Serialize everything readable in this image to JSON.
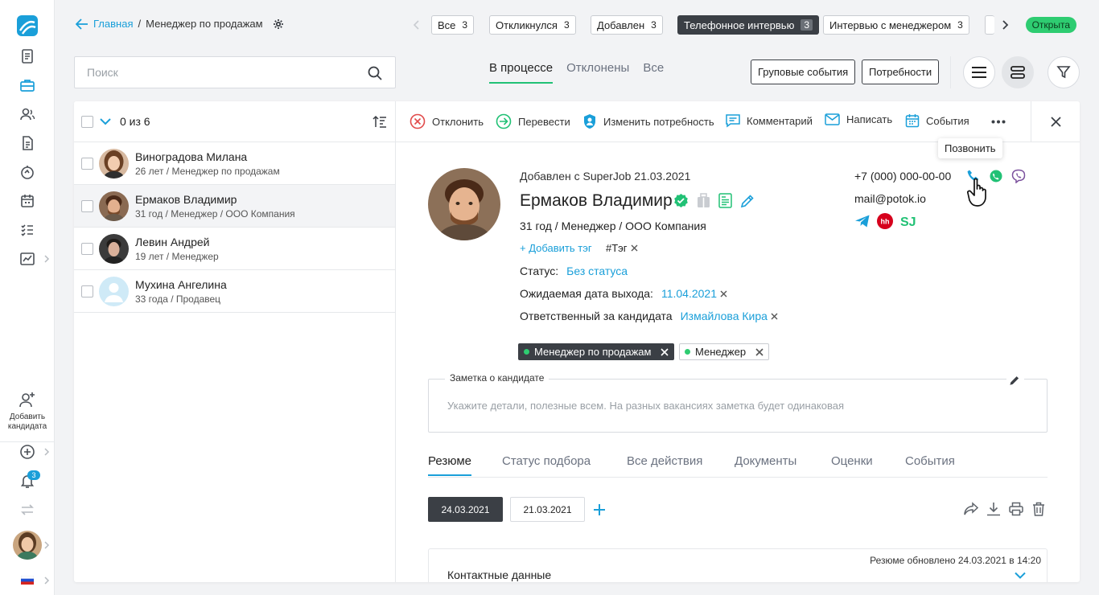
{
  "breadcrumb": {
    "home": "Главная",
    "separator": "/",
    "current": "Менеджер по продажам"
  },
  "stages": [
    {
      "label": "Все",
      "count": "3"
    },
    {
      "label": "Откликнулся",
      "count": "3"
    },
    {
      "label": "Добавлен",
      "count": "3"
    },
    {
      "label": "Телефонное интервью",
      "count": "3",
      "active": true
    },
    {
      "label": "Интервью с менеджером",
      "count": "3"
    }
  ],
  "vacancy_status": "Открыта",
  "search": {
    "placeholder": "Поиск"
  },
  "subtabs": [
    "В процессе",
    "Отклонены",
    "Все"
  ],
  "buttons": {
    "group_events": "Груповые события",
    "needs": "Потребности"
  },
  "list": {
    "counter": "0 из 6",
    "candidates": [
      {
        "name": "Виноградова Милана",
        "sub": "26 лет / Менеджер по продажам"
      },
      {
        "name": "Ермаков Владимир",
        "sub": "31 год / Менеджер / ООО Компания"
      },
      {
        "name": "Левин Андрей",
        "sub": "19 лет / Менеджер"
      },
      {
        "name": "Мухина Ангелина",
        "sub": "33 года / Продавец"
      }
    ]
  },
  "actions": {
    "reject": "Отклонить",
    "transfer": "Перевести",
    "change_need": "Изменить потребность",
    "comment": "Комментарий",
    "write": "Написать",
    "events": "События"
  },
  "tooltip": "Позвонить",
  "candidate": {
    "added": "Добавлен с SuperJob 21.03.2021",
    "name": "Ермаков Владимир",
    "info": "31 год / Менеджер / ООО Компания",
    "add_tag": "+ Добавить тэг",
    "tag": "#Тэг",
    "status_label": "Статус:",
    "status_value": "Без статуса",
    "date_label": "Ожидаемая дата выхода:",
    "date_value": "11.04.2021",
    "resp_label": "Ответственный за кандидата",
    "resp_value": "Измайлова Кира",
    "phone": "+7 (000) 000-00-00",
    "email": "mail@potok.io",
    "vacancies": [
      "Менеджер по продажам",
      "Менеджер"
    ]
  },
  "note": {
    "label": "Заметка о кандидате",
    "placeholder": "Укажите детали, полезные всем. На разных вакансиях заметка будет одинаковая"
  },
  "resume_tabs": [
    "Резюме",
    "Статус подбора",
    "Все действия",
    "Документы",
    "Оценки",
    "События"
  ],
  "resume_dates": [
    "24.03.2021",
    "21.03.2021"
  ],
  "resume_card": {
    "updated": "Резюме обновлено 24.03.2021 в 14:20",
    "section": "Контактные данные"
  },
  "sidebar": {
    "add_candidate": "Добавить кандидата",
    "notif_count": "3"
  },
  "colors": {
    "accent": "#1a9fd9",
    "green": "#21c175",
    "dark": "#3b3f45"
  }
}
